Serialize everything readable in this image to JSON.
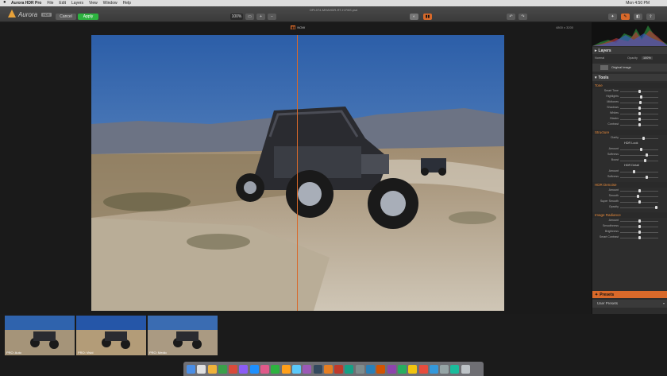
{
  "menubar": {
    "app_name": "Aurora HDR Pro",
    "items": [
      "File",
      "Edit",
      "Layers",
      "View",
      "Window",
      "Help"
    ],
    "clock": "Mon 4:50 PM"
  },
  "toolbar": {
    "logo_text": "Aurora",
    "logo_badge": "HDR",
    "cancel_label": "Cancel",
    "apply_label": "Apply",
    "zoom_label": "100%",
    "document_title": "OPL074-MHAHDR-RT-H.PAS.psd"
  },
  "viewer": {
    "compare_label": "NOW",
    "image_size": "4800 x 3200"
  },
  "panel": {
    "layers_title": "Layers",
    "blend_mode": "Normal",
    "opacity_label": "Opacity",
    "opacity_value": "100%",
    "layer_name": "Original Image",
    "tools_title": "Tools",
    "sections": [
      {
        "title": "Tone",
        "sliders": [
          {
            "label": "Smart Tone",
            "value": 0.5
          },
          {
            "label": "Highlights",
            "value": 0.55
          },
          {
            "label": "Midtones",
            "value": 0.52
          },
          {
            "label": "Shadows",
            "value": 0.5
          },
          {
            "label": "Whites",
            "value": 0.5
          },
          {
            "label": "Blacks",
            "value": 0.5
          },
          {
            "label": "Contrast",
            "value": 0.5
          }
        ]
      },
      {
        "title": "Structure",
        "sliders": [
          {
            "label": "Clarity",
            "value": 0.6
          }
        ],
        "subgroups": [
          {
            "title": "HDR Look",
            "sliders": [
              {
                "label": "Amount",
                "value": 0.55
              },
              {
                "label": "Softness",
                "value": 0.7
              },
              {
                "label": "Boost",
                "value": 0.65
              }
            ]
          },
          {
            "title": "HDR Detail",
            "sliders": [
              {
                "label": "Amount",
                "value": 0.35
              },
              {
                "label": "Softness",
                "value": 0.7
              }
            ]
          }
        ]
      },
      {
        "title": "HDR Denoise",
        "sliders": [
          {
            "label": "Amount",
            "value": 0.5
          },
          {
            "label": "Smooth",
            "value": 0.45
          },
          {
            "label": "Super Smooth",
            "value": 0.5
          },
          {
            "label": "Opacity",
            "value": 0.95
          }
        ]
      },
      {
        "title": "Image Radiance",
        "sliders": [
          {
            "label": "Amount",
            "value": 0.5
          },
          {
            "label": "Smoothness",
            "value": 0.5
          },
          {
            "label": "Brightness",
            "value": 0.5
          },
          {
            "label": "Smart Contrast",
            "value": 0.5
          }
        ]
      }
    ],
    "presets_title": "Presets",
    "user_presets": "User Presets"
  },
  "filmstrip": {
    "items": [
      {
        "label": "PRO: Auto"
      },
      {
        "label": "PRO: Vivid"
      },
      {
        "label": "PRO: Medio"
      }
    ]
  },
  "colors": {
    "accent": "#d8692a",
    "apply_green": "#2db33f",
    "panel_bg": "#2d2d2d"
  }
}
